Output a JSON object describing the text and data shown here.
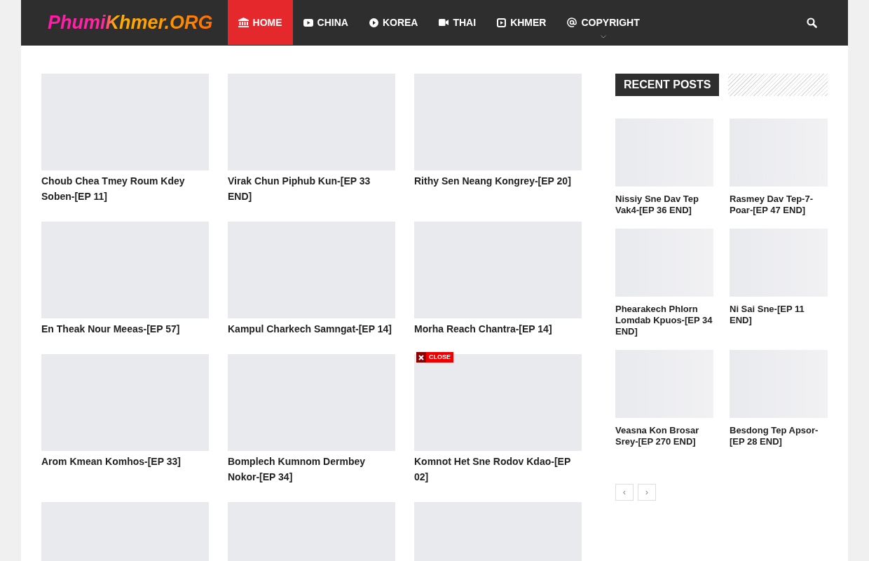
{
  "header": {
    "logo": "PhumiKhmer.ORG",
    "nav": [
      {
        "label": "HOME",
        "selected": true,
        "has_submenu": false
      },
      {
        "label": "CHINA",
        "selected": false,
        "has_submenu": false
      },
      {
        "label": "KOREA",
        "selected": false,
        "has_submenu": false
      },
      {
        "label": "THAI",
        "selected": false,
        "has_submenu": false
      },
      {
        "label": "KHMER",
        "selected": false,
        "has_submenu": false
      },
      {
        "label": "COPYRIGHT",
        "selected": false,
        "has_submenu": true
      }
    ]
  },
  "posts": [
    {
      "kind": "post",
      "title": "Choub Chea Tmey Roum Kdey Soben-[EP 11]"
    },
    {
      "kind": "post",
      "title": "Virak Chun Piphub Kun-[EP 33 END]"
    },
    {
      "kind": "post",
      "title": "Rithy Sen Neang Kongrey-[EP 20]"
    },
    {
      "kind": "post",
      "title": "En Theak Nour Meeas-[EP 57]"
    },
    {
      "kind": "post",
      "title": "Kampul Charkech Samngat-[EP 14]"
    },
    {
      "kind": "post",
      "title": "Morha Reach Chantra-[EP 14]"
    },
    {
      "kind": "post",
      "title": "Arom Kmean Komhos-[EP 33]"
    },
    {
      "kind": "post",
      "title": "Bomplech Kumnom Dermbey Nokor-[EP 34]"
    },
    {
      "kind": "post",
      "title": "Komnot Het Sne Rodov Kdao-[EP 02]"
    },
    {
      "kind": "thumbnail-only"
    },
    {
      "kind": "thumbnail-only"
    },
    {
      "kind": "thumbnail-only"
    }
  ],
  "ad_overlay": {
    "close_label": "CLOSE"
  },
  "sidebar": {
    "heading": "RECENT POSTS",
    "posts": [
      {
        "title": "Nissiy Sne Dav Tep Vak4-[EP 36 END]"
      },
      {
        "title": "Rasmey Dav Tep-7-Poar-[EP 47 END]"
      },
      {
        "title": "Phearakech Phlorn Lomdab Kpuos-[EP 34 END]"
      },
      {
        "title": "Ni Sai Sne-[EP 11 END]"
      },
      {
        "title": "Veasna Kon Brosar Srey-[EP 270 END]"
      },
      {
        "title": "Besdong Tep Apsor-[EP 28 END]"
      }
    ],
    "pager": {
      "prev": "‹",
      "next": "›"
    }
  }
}
